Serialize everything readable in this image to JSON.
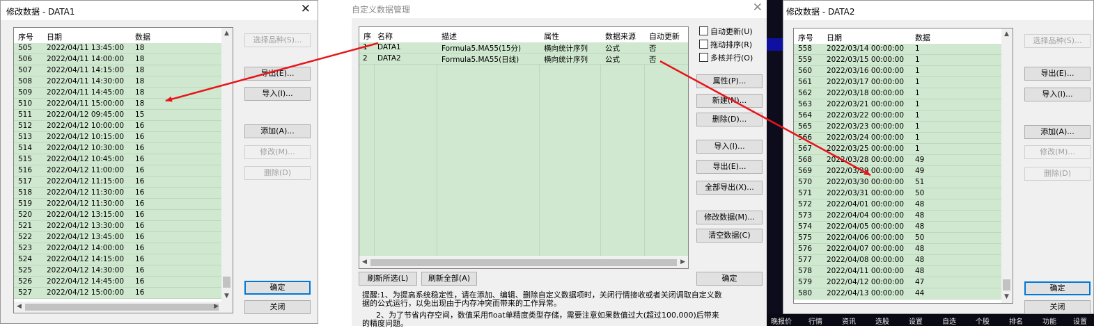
{
  "win1": {
    "title": "修改数据 - DATA1",
    "columns": [
      "序号",
      "日期",
      "数据"
    ],
    "rows": [
      [
        "505",
        "2022/04/11 13:45:00",
        "18"
      ],
      [
        "506",
        "2022/04/11 14:00:00",
        "18"
      ],
      [
        "507",
        "2022/04/11 14:15:00",
        "18"
      ],
      [
        "508",
        "2022/04/11 14:30:00",
        "18"
      ],
      [
        "509",
        "2022/04/11 14:45:00",
        "18"
      ],
      [
        "510",
        "2022/04/11 15:00:00",
        "18"
      ],
      [
        "511",
        "2022/04/12 09:45:00",
        "15"
      ],
      [
        "512",
        "2022/04/12 10:00:00",
        "16"
      ],
      [
        "513",
        "2022/04/12 10:15:00",
        "16"
      ],
      [
        "514",
        "2022/04/12 10:30:00",
        "16"
      ],
      [
        "515",
        "2022/04/12 10:45:00",
        "16"
      ],
      [
        "516",
        "2022/04/12 11:00:00",
        "16"
      ],
      [
        "517",
        "2022/04/12 11:15:00",
        "16"
      ],
      [
        "518",
        "2022/04/12 11:30:00",
        "16"
      ],
      [
        "519",
        "2022/04/12 11:30:00",
        "16"
      ],
      [
        "520",
        "2022/04/12 13:15:00",
        "16"
      ],
      [
        "521",
        "2022/04/12 13:30:00",
        "16"
      ],
      [
        "522",
        "2022/04/12 13:45:00",
        "16"
      ],
      [
        "523",
        "2022/04/12 14:00:00",
        "16"
      ],
      [
        "524",
        "2022/04/12 14:15:00",
        "16"
      ],
      [
        "525",
        "2022/04/12 14:30:00",
        "16"
      ],
      [
        "526",
        "2022/04/12 14:45:00",
        "16"
      ],
      [
        "527",
        "2022/04/12 15:00:00",
        "16"
      ]
    ],
    "buttons": {
      "select": "选择品种(S)...",
      "export": "导出(E)...",
      "import": "导入(I)...",
      "add": "添加(A)...",
      "modify": "修改(M)...",
      "delete": "删除(D)",
      "ok": "确定",
      "close": "关闭"
    }
  },
  "win2": {
    "title": "自定义数据管理",
    "columns": [
      "序",
      "名称",
      "描述",
      "属性",
      "数据来源",
      "自动更新"
    ],
    "rows": [
      [
        "1",
        "DATA1",
        "Formula5.MA55(15分)",
        "横向统计序列",
        "公式",
        "否"
      ],
      [
        "2",
        "DATA2",
        "Formula5.MA55(日线)",
        "横向统计序列",
        "公式",
        "否"
      ]
    ],
    "checkboxes": [
      "自动更新(U)",
      "拖动排序(R)",
      "多核并行(O)"
    ],
    "buttons": {
      "attr": "属性(P)...",
      "new": "新建(N)...",
      "delete": "删除(D)...",
      "import": "导入(I)...",
      "export": "导出(E)...",
      "export_all": "全部导出(X)...",
      "modify": "修改数据(M)...",
      "clear": "清空数据(C)",
      "refresh_sel": "刷新所选(L)",
      "refresh_all": "刷新全部(A)",
      "ok": "确定"
    },
    "hint1": "提醒:1、为提高系统稳定性，请在添加、编辑、删除自定义数据项时，关闭行情接收或者关闭调取自定义数",
    "hint1b": "据的公式运行，以免出现由于内存冲突而带来的工作异常。",
    "hint2": "2、为了节省内存空间，数值采用float单精度类型存储，需要注意如果数值过大(超过100,000)后带来",
    "hint2b": "的精度问题。"
  },
  "win3": {
    "title": "修改数据 - DATA2",
    "columns": [
      "序号",
      "日期",
      "数据"
    ],
    "rows": [
      [
        "558",
        "2022/03/14 00:00:00",
        "1"
      ],
      [
        "559",
        "2022/03/15 00:00:00",
        "1"
      ],
      [
        "560",
        "2022/03/16 00:00:00",
        "1"
      ],
      [
        "561",
        "2022/03/17 00:00:00",
        "1"
      ],
      [
        "562",
        "2022/03/18 00:00:00",
        "1"
      ],
      [
        "563",
        "2022/03/21 00:00:00",
        "1"
      ],
      [
        "564",
        "2022/03/22 00:00:00",
        "1"
      ],
      [
        "565",
        "2022/03/23 00:00:00",
        "1"
      ],
      [
        "566",
        "2022/03/24 00:00:00",
        "1"
      ],
      [
        "567",
        "2022/03/25 00:00:00",
        "1"
      ],
      [
        "568",
        "2022/03/28 00:00:00",
        "49"
      ],
      [
        "569",
        "2022/03/29 00:00:00",
        "49"
      ],
      [
        "570",
        "2022/03/30 00:00:00",
        "51"
      ],
      [
        "571",
        "2022/03/31 00:00:00",
        "50"
      ],
      [
        "572",
        "2022/04/01 00:00:00",
        "48"
      ],
      [
        "573",
        "2022/04/04 00:00:00",
        "48"
      ],
      [
        "574",
        "2022/04/05 00:00:00",
        "48"
      ],
      [
        "575",
        "2022/04/06 00:00:00",
        "50"
      ],
      [
        "576",
        "2022/04/07 00:00:00",
        "48"
      ],
      [
        "577",
        "2022/04/08 00:00:00",
        "48"
      ],
      [
        "578",
        "2022/04/11 00:00:00",
        "48"
      ],
      [
        "579",
        "2022/04/12 00:00:00",
        "47"
      ],
      [
        "580",
        "2022/04/13 00:00:00",
        "44"
      ]
    ],
    "buttons": {
      "select": "选择品种(S)...",
      "export": "导出(E)...",
      "import": "导入(I)...",
      "add": "添加(A)...",
      "modify": "修改(M)...",
      "delete": "删除(D)",
      "ok": "确定",
      "close": "关闭"
    }
  },
  "taskbar": [
    "晚报价",
    "行情",
    "资讯",
    "选股",
    "设置",
    "自选",
    "个股",
    "排名",
    "功能",
    "设置"
  ],
  "colors": {
    "row_green": "#cfe8cf",
    "arrow_red": "#e8141a",
    "focus_blue": "#0078d7"
  }
}
